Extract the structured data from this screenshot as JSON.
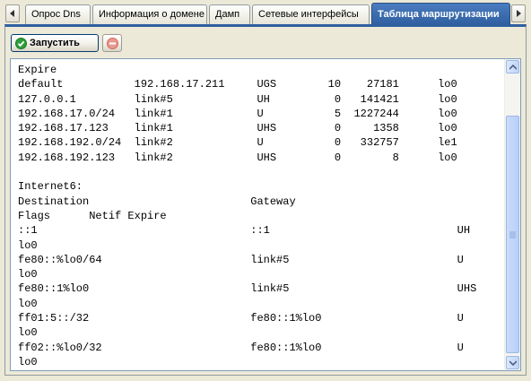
{
  "tabs": [
    {
      "label": "Опрос Dns",
      "active": false
    },
    {
      "label": "Информация о домене",
      "active": false
    },
    {
      "label": "Дамп",
      "active": false
    },
    {
      "label": "Сетевые интерфейсы",
      "active": false
    },
    {
      "label": "Таблица маршрутизации",
      "active": true
    }
  ],
  "toolbar": {
    "run_label": "Запустить"
  },
  "console": {
    "lines": [
      "Expire",
      "default           192.168.17.211     UGS        10    27181      lo0",
      "127.0.0.1         link#5             UH          0   141421      lo0",
      "192.168.17.0/24   link#1             U           5  1227244      lo0",
      "192.168.17.123    link#1             UHS         0     1358      lo0",
      "192.168.192.0/24  link#2             U           0   332757      le1",
      "192.168.192.123   link#2             UHS         0        8      lo0",
      "",
      "Internet6:",
      "Destination                         Gateway",
      "Flags      Netif Expire",
      "::1                                 ::1                             UH",
      "lo0",
      "fe80::%lo0/64                       link#5                          U",
      "lo0",
      "fe80::1%lo0                         link#5                          UHS",
      "lo0",
      "ff01:5::/32                         fe80::1%lo0                     U",
      "lo0",
      "ff02::%lo0/32                       fe80::1%lo0                     U",
      "lo0"
    ]
  },
  "colors": {
    "active_tab": "#2f5f9f",
    "run_icon": "#2e9e3a",
    "stop_icon": "#e05a4a"
  }
}
